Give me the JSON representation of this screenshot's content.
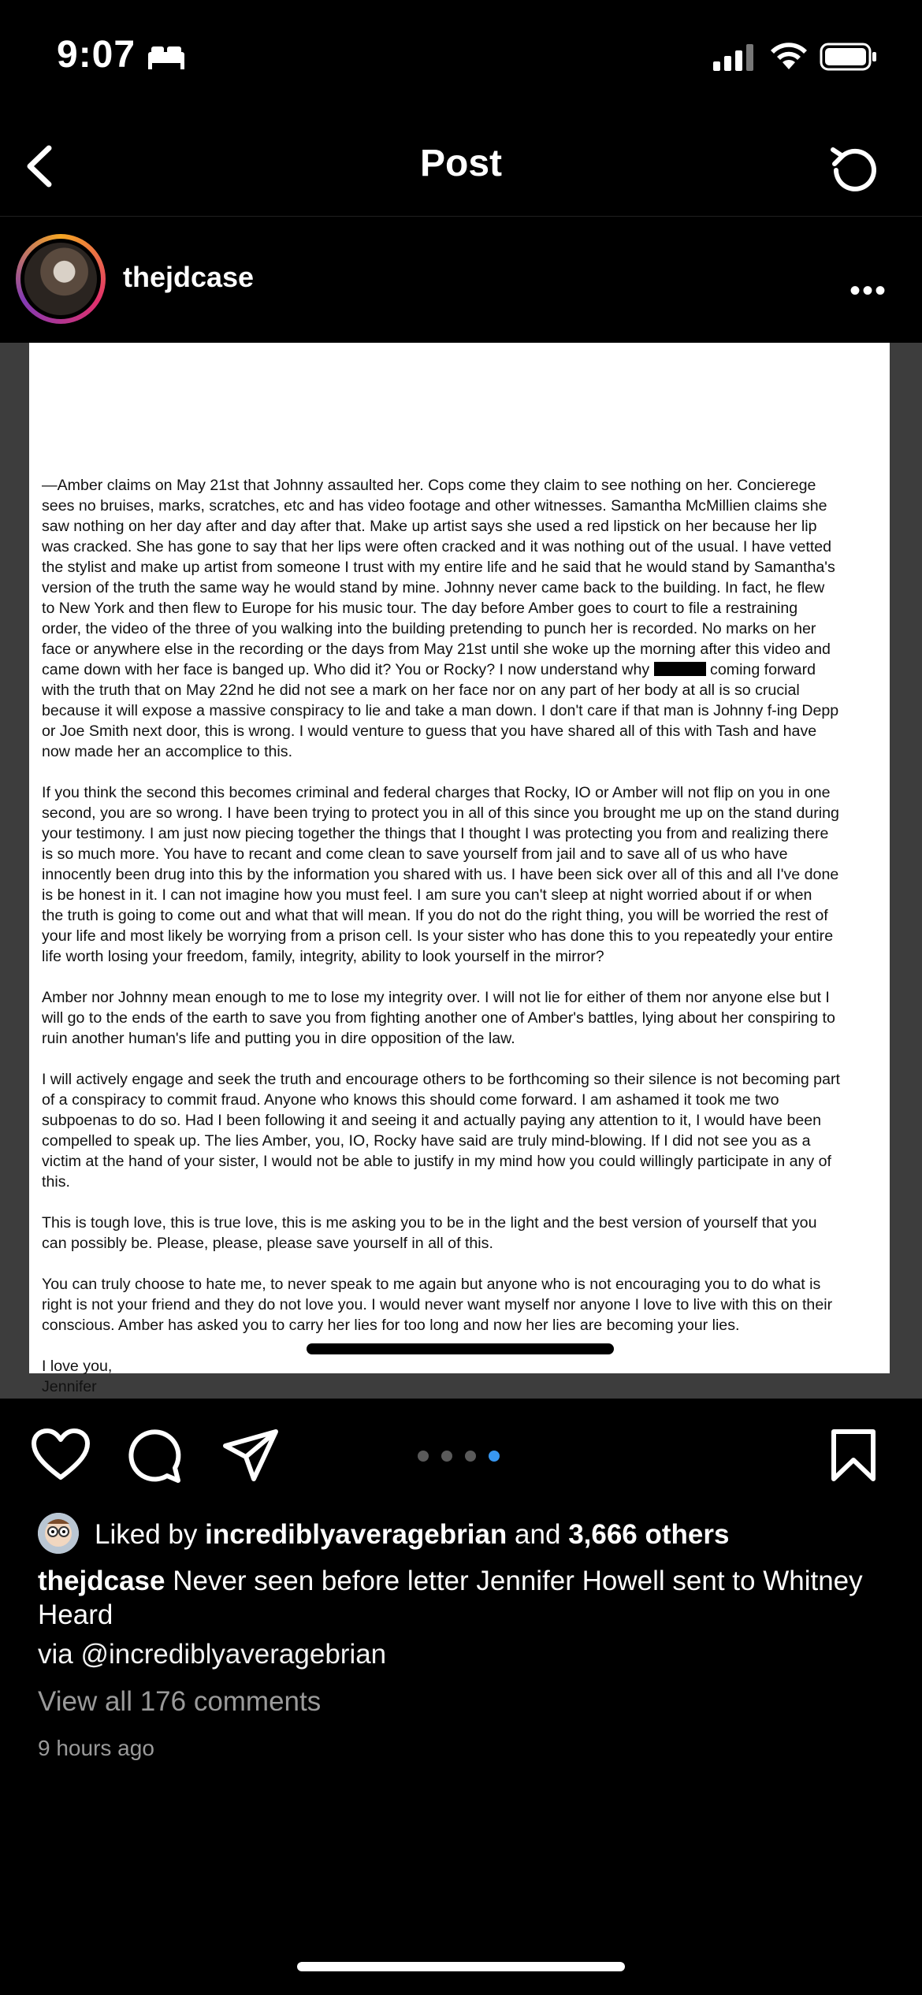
{
  "status": {
    "time": "9:07"
  },
  "nav": {
    "title": "Post"
  },
  "post": {
    "username": "thejdcase",
    "more_label": "•••",
    "letter": [
      "—Amber claims on May 21st that Johnny assaulted her.  Cops come they claim to see nothing on her.  Concierege\nsees no bruises, marks, scratches, etc and has video footage and other witnesses.  Samantha McMillien claims she\nsaw nothing on her day after and day after that.  Make up artist says she used a red lipstick on her because her lip\nwas cracked.  She has gone to say that her lips were often cracked and it was nothing out of the usual.  I have vetted\nthe stylist and make up artist from someone I trust with my entire life and he said that he would stand by Samantha's\nversion of the truth the same way he would stand by mine.  Johnny never came back to the building.  In fact, he flew\nto New York and then flew to Europe for his music tour.  The day before Amber goes to court to file a restraining\norder, the video of the three of you walking into the building pretending to punch her is recorded.  No marks on her\nface or anywhere else in the recording or the days from May 21st until she woke up the morning after this video and\ncame down with her face is banged up.  Who did it?  You or Rocky?  I now understand why",
      "coming forward\nwith the truth that on May 22nd he did not see a mark on her face nor on any part of her body at all is so crucial\nbecause it will expose a massive conspiracy to lie and take a man down.  I don't care if that man is Johnny f-ing Depp\nor Joe Smith next door, this is wrong.  I would venture to guess that you have shared all of this with Tash and have\nnow made her an accomplice to this.",
      "If you think the second this becomes criminal and federal charges that Rocky, IO or Amber will not flip on you in one\nsecond, you are so wrong.  I have been trying to protect you in all of this since you brought me up on the stand during\nyour testimony.  I am just now piecing together the things that I thought I was protecting you from and realizing there\nis so much more.  You have to recant and come clean to save yourself from jail and to save all of us who have\ninnocently been drug into this by the information you shared with us.  I have been sick over all of this and all I've done\nis be honest in it.  I can not imagine how you must feel.  I am sure you can't sleep at night worried about if or when\nthe truth is going to come out and what that will mean.  If you do not do the right thing, you will be worried the rest of\nyour life and most likely be worrying from a prison cell.  Is your sister who has done this to you repeatedly your entire\nlife worth losing your freedom, family, integrity, ability to look yourself in the mirror?",
      "Amber nor Johnny mean enough to me to lose my integrity over.  I will not lie for either of them nor anyone else but I\nwill go to the ends of the earth to save you from fighting another one of Amber's battles, lying about her conspiring to\nruin another human's life and putting you in dire opposition of the law.",
      "I will actively engage and seek the truth and encourage others to be forthcoming so their silence is not becoming part\nof a conspiracy to commit fraud.  Anyone who knows this should come forward.  I am ashamed it took me two\nsubpoenas to do so.  Had I been following it and seeing it and actually paying any attention to it, I would have been\ncompelled to speak up.  The lies Amber, you, IO, Rocky have said are truly mind-blowing.  If I did not see you as a\nvictim at the hand of your sister, I would not be able to justify in my mind how you could willingly participate in any of\nthis.",
      "This is tough love, this is true love, this is me asking you to be in the light and the best version of yourself that you\ncan possibly be.  Please, please, please save yourself in all of this.",
      "You can truly choose to hate me, to never speak to me again but anyone who is not encouraging you to do what is\nright is not your friend and they do not love you.  I would never want myself nor anyone I love to live with this on their\nconscious.  Amber has asked you to carry her lies for too long and now her lies are becoming your lies.",
      "I love you,\nJennifer"
    ],
    "carousel": {
      "count": 4,
      "active": 4
    },
    "likes": {
      "prefix": "Liked by ",
      "user": "incrediblyaveragebrian",
      "middle": " and ",
      "others": "3,666 others"
    },
    "caption": {
      "user": "thejdcase",
      "text": " Never seen before letter Jennifer Howell sent to Whitney Heard"
    },
    "via": "via @incrediblyaveragebrian",
    "view_comments": "View all 176 comments",
    "time_ago": "9 hours ago"
  },
  "colors": {
    "background": "#000000",
    "accent": "#3897f0",
    "muted": "#9a9a9a"
  }
}
